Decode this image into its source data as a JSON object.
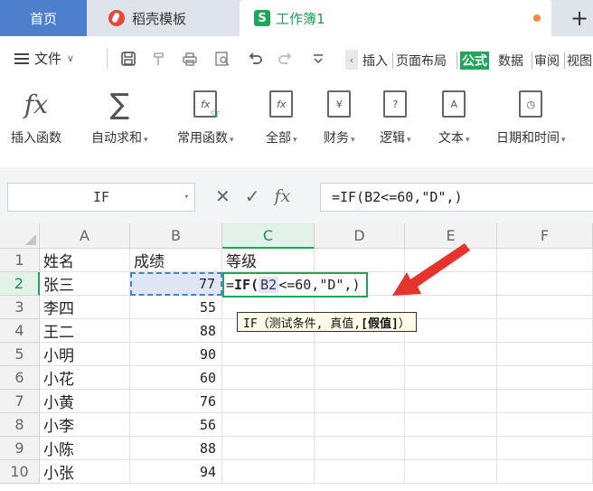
{
  "tabs": {
    "home": "首页",
    "template": "稻壳模板",
    "workbook": "工作簿1",
    "workbook_icon": "S",
    "add": "+"
  },
  "menu": {
    "file": "文件",
    "ribbon_tabs": [
      "插入",
      "页面布局",
      "公式",
      "数据",
      "审阅",
      "视图"
    ],
    "active_tab": "公式"
  },
  "ribbon": {
    "buttons": [
      {
        "label": "插入函数",
        "icon": "fx-icon"
      },
      {
        "label": "自动求和",
        "icon": "sigma-icon"
      },
      {
        "label": "常用函数",
        "icon": "star-fx-icon"
      },
      {
        "label": "全部",
        "icon": "fx-doc-icon"
      },
      {
        "label": "财务",
        "icon": "yen-doc-icon"
      },
      {
        "label": "逻辑",
        "icon": "question-doc-icon"
      },
      {
        "label": "文本",
        "icon": "text-doc-icon"
      },
      {
        "label": "日期和时间",
        "icon": "clock-doc-icon"
      }
    ]
  },
  "formula_bar": {
    "name_box": "IF",
    "fx_label": "fx",
    "formula": "=IF(B2<=60,\"D\",)"
  },
  "grid": {
    "columns": [
      "A",
      "B",
      "C",
      "D",
      "E",
      "F"
    ],
    "rows": [
      "1",
      "2",
      "3",
      "4",
      "5",
      "6",
      "7",
      "8",
      "9",
      "10"
    ],
    "headers": {
      "a": "姓名",
      "b": "成绩",
      "c": "等级"
    },
    "data": [
      {
        "name": "张三",
        "score": "77"
      },
      {
        "name": "李四",
        "score": "55"
      },
      {
        "name": "王二",
        "score": "88"
      },
      {
        "name": "小明",
        "score": "90"
      },
      {
        "name": "小花",
        "score": "60"
      },
      {
        "name": "小黄",
        "score": "76"
      },
      {
        "name": "小李",
        "score": "56"
      },
      {
        "name": "小陈",
        "score": "88"
      },
      {
        "name": "小张",
        "score": "94"
      }
    ],
    "editing": {
      "prefix": "=",
      "func": "IF(",
      "ref": "B2",
      "rest": "<=60,\"D\",)"
    },
    "tooltip": {
      "text": "IF（测试条件, 真值, ",
      "bold": "[假值]",
      "close": "）"
    }
  },
  "colors": {
    "accent_green": "#1ea75a",
    "home_tab_blue": "#4d7fcd",
    "arrow_red": "#e8322c"
  }
}
